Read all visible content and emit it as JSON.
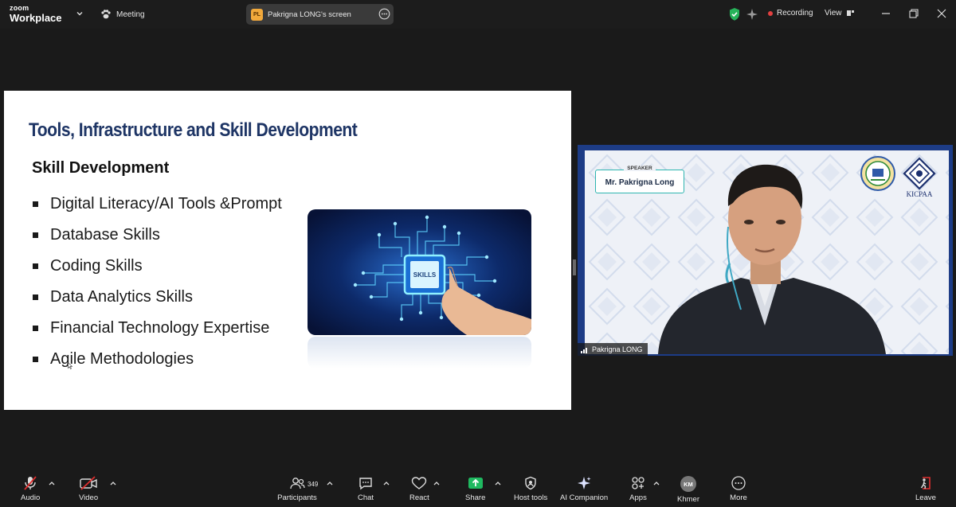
{
  "app": {
    "brand_top": "zoom",
    "brand_bottom": "Workplace"
  },
  "topbar": {
    "meeting_label": "Meeting",
    "share_initials": "PL",
    "share_label": "Pakrigna LONG's screen",
    "recording_label": "Recording",
    "view_label": "View"
  },
  "slide": {
    "title": "Tools, Infrastructure and Skill Development",
    "heading": "Skill Development",
    "items": [
      "Digital Literacy/AI Tools &Prompt",
      "Database Skills",
      "Coding Skills",
      "Data Analytics Skills",
      "Financial Technology Expertise",
      "Agile Methodologies"
    ],
    "image_text": "SKILLS"
  },
  "video": {
    "speaker_label": "SPEAKER",
    "speaker_name": "Mr. Pakrigna Long",
    "participant_name": "Pakrigna LONG",
    "logo_text": "KICPAA"
  },
  "toolbar": {
    "audio": "Audio",
    "video": "Video",
    "participants": "Participants",
    "participants_count": "349",
    "chat": "Chat",
    "react": "React",
    "share": "Share",
    "host_tools": "Host tools",
    "ai_companion": "AI Companion",
    "apps": "Apps",
    "language_initials": "KM",
    "language": "Khmer",
    "more": "More",
    "leave": "Leave"
  },
  "colors": {
    "background": "#1a1a1a",
    "slide_title": "#1e3565",
    "recording_dot": "#e34040",
    "share_green": "#1fb960",
    "leave_red": "#e02e2e",
    "video_frame": "#1d3c86"
  }
}
